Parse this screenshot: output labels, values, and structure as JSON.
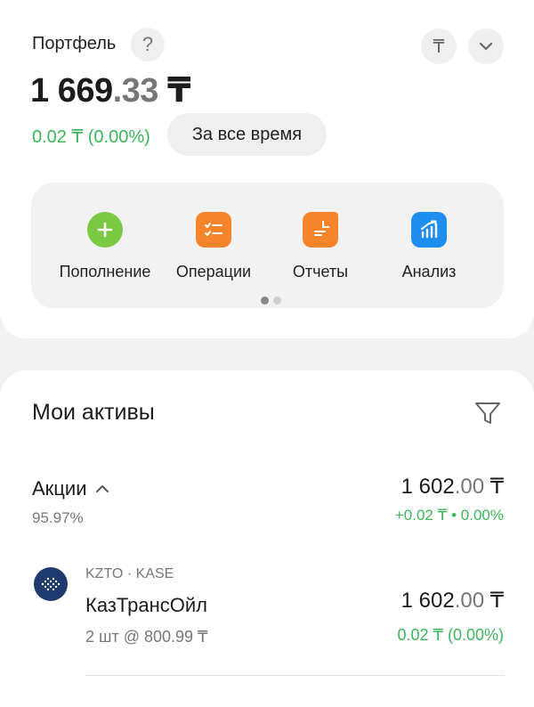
{
  "portfolio": {
    "title": "Портфель",
    "help_symbol": "?",
    "currency_symbol": "₸",
    "total_int": "1 669",
    "total_dec": ".33",
    "total_currency": " ₸",
    "change": "0.02 ₸ (0.00%)",
    "period_label": "За все время"
  },
  "actions": [
    {
      "label": "Пополнение",
      "icon": "plus-icon",
      "color": "#7ac943"
    },
    {
      "label": "Операции",
      "icon": "operations-icon",
      "color": "#f5842b"
    },
    {
      "label": "Отчеты",
      "icon": "report-icon",
      "color": "#f5842b"
    },
    {
      "label": "Анализ",
      "icon": "chart-icon",
      "color": "#1f8ef1"
    }
  ],
  "pager": {
    "pages": 2,
    "active": 0
  },
  "assets": {
    "title": "Мои активы",
    "category": {
      "name": "Акции",
      "share": "95.97%",
      "value_int": "1 602",
      "value_dec": ".00",
      "value_currency": " ₸",
      "change": "+0.02 ₸ • 0.00%"
    },
    "holding": {
      "meta": "KZTO · KASE",
      "name": "КазТрансОйл",
      "quantity": "2 шт @ 800.99 ₸",
      "value_int": "1 602",
      "value_dec": ".00",
      "value_currency": " ₸",
      "change": "0.02 ₸  (0.00%)"
    }
  }
}
